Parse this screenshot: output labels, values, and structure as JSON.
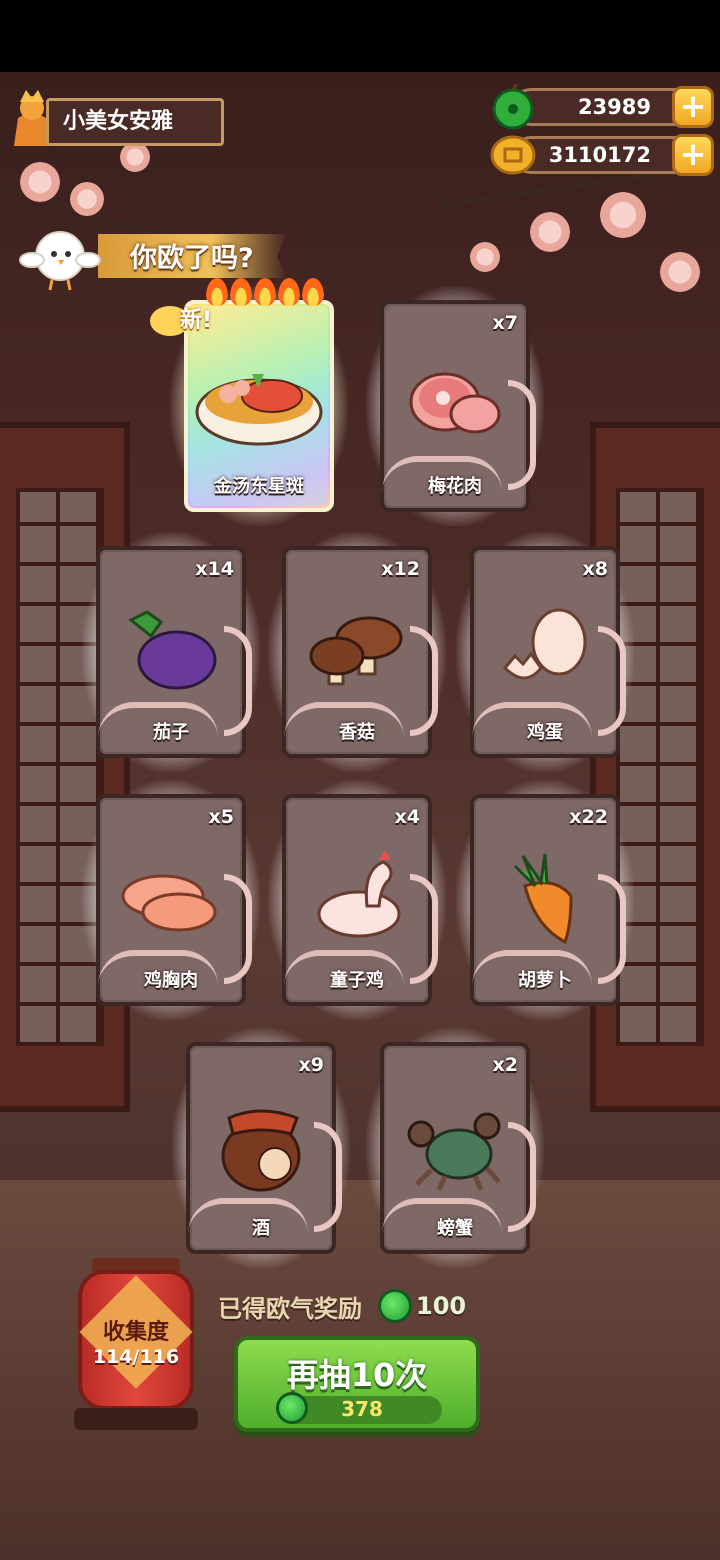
{
  "player": {
    "name": "小美女安雅"
  },
  "currencies": {
    "jade": {
      "amount": "23989",
      "icon": "jade-coin-icon",
      "color": "#2fae3a"
    },
    "gold": {
      "amount": "3110172",
      "icon": "gold-coin-icon",
      "color": "#f0b02a"
    },
    "plus_label": "+"
  },
  "banner": {
    "text": "你欧了吗?"
  },
  "cards": [
    {
      "name": "金汤东星斑",
      "count": "",
      "special": true,
      "new_label": "新!",
      "flames": 5
    },
    {
      "name": "梅花肉",
      "count": "x7"
    },
    {
      "name": "茄子",
      "count": "x14"
    },
    {
      "name": "香菇",
      "count": "x12"
    },
    {
      "name": "鸡蛋",
      "count": "x8"
    },
    {
      "name": "鸡胸肉",
      "count": "x5"
    },
    {
      "name": "童子鸡",
      "count": "x4"
    },
    {
      "name": "胡萝卜",
      "count": "x22"
    },
    {
      "name": "酒",
      "count": "x9"
    },
    {
      "name": "螃蟹",
      "count": "x2"
    }
  ],
  "collection": {
    "label": "收集度",
    "progress": "114/116"
  },
  "reward": {
    "label": "已得欧气奖励",
    "amount": "100"
  },
  "draw_button": {
    "label": "再抽10次",
    "cost": "378"
  }
}
